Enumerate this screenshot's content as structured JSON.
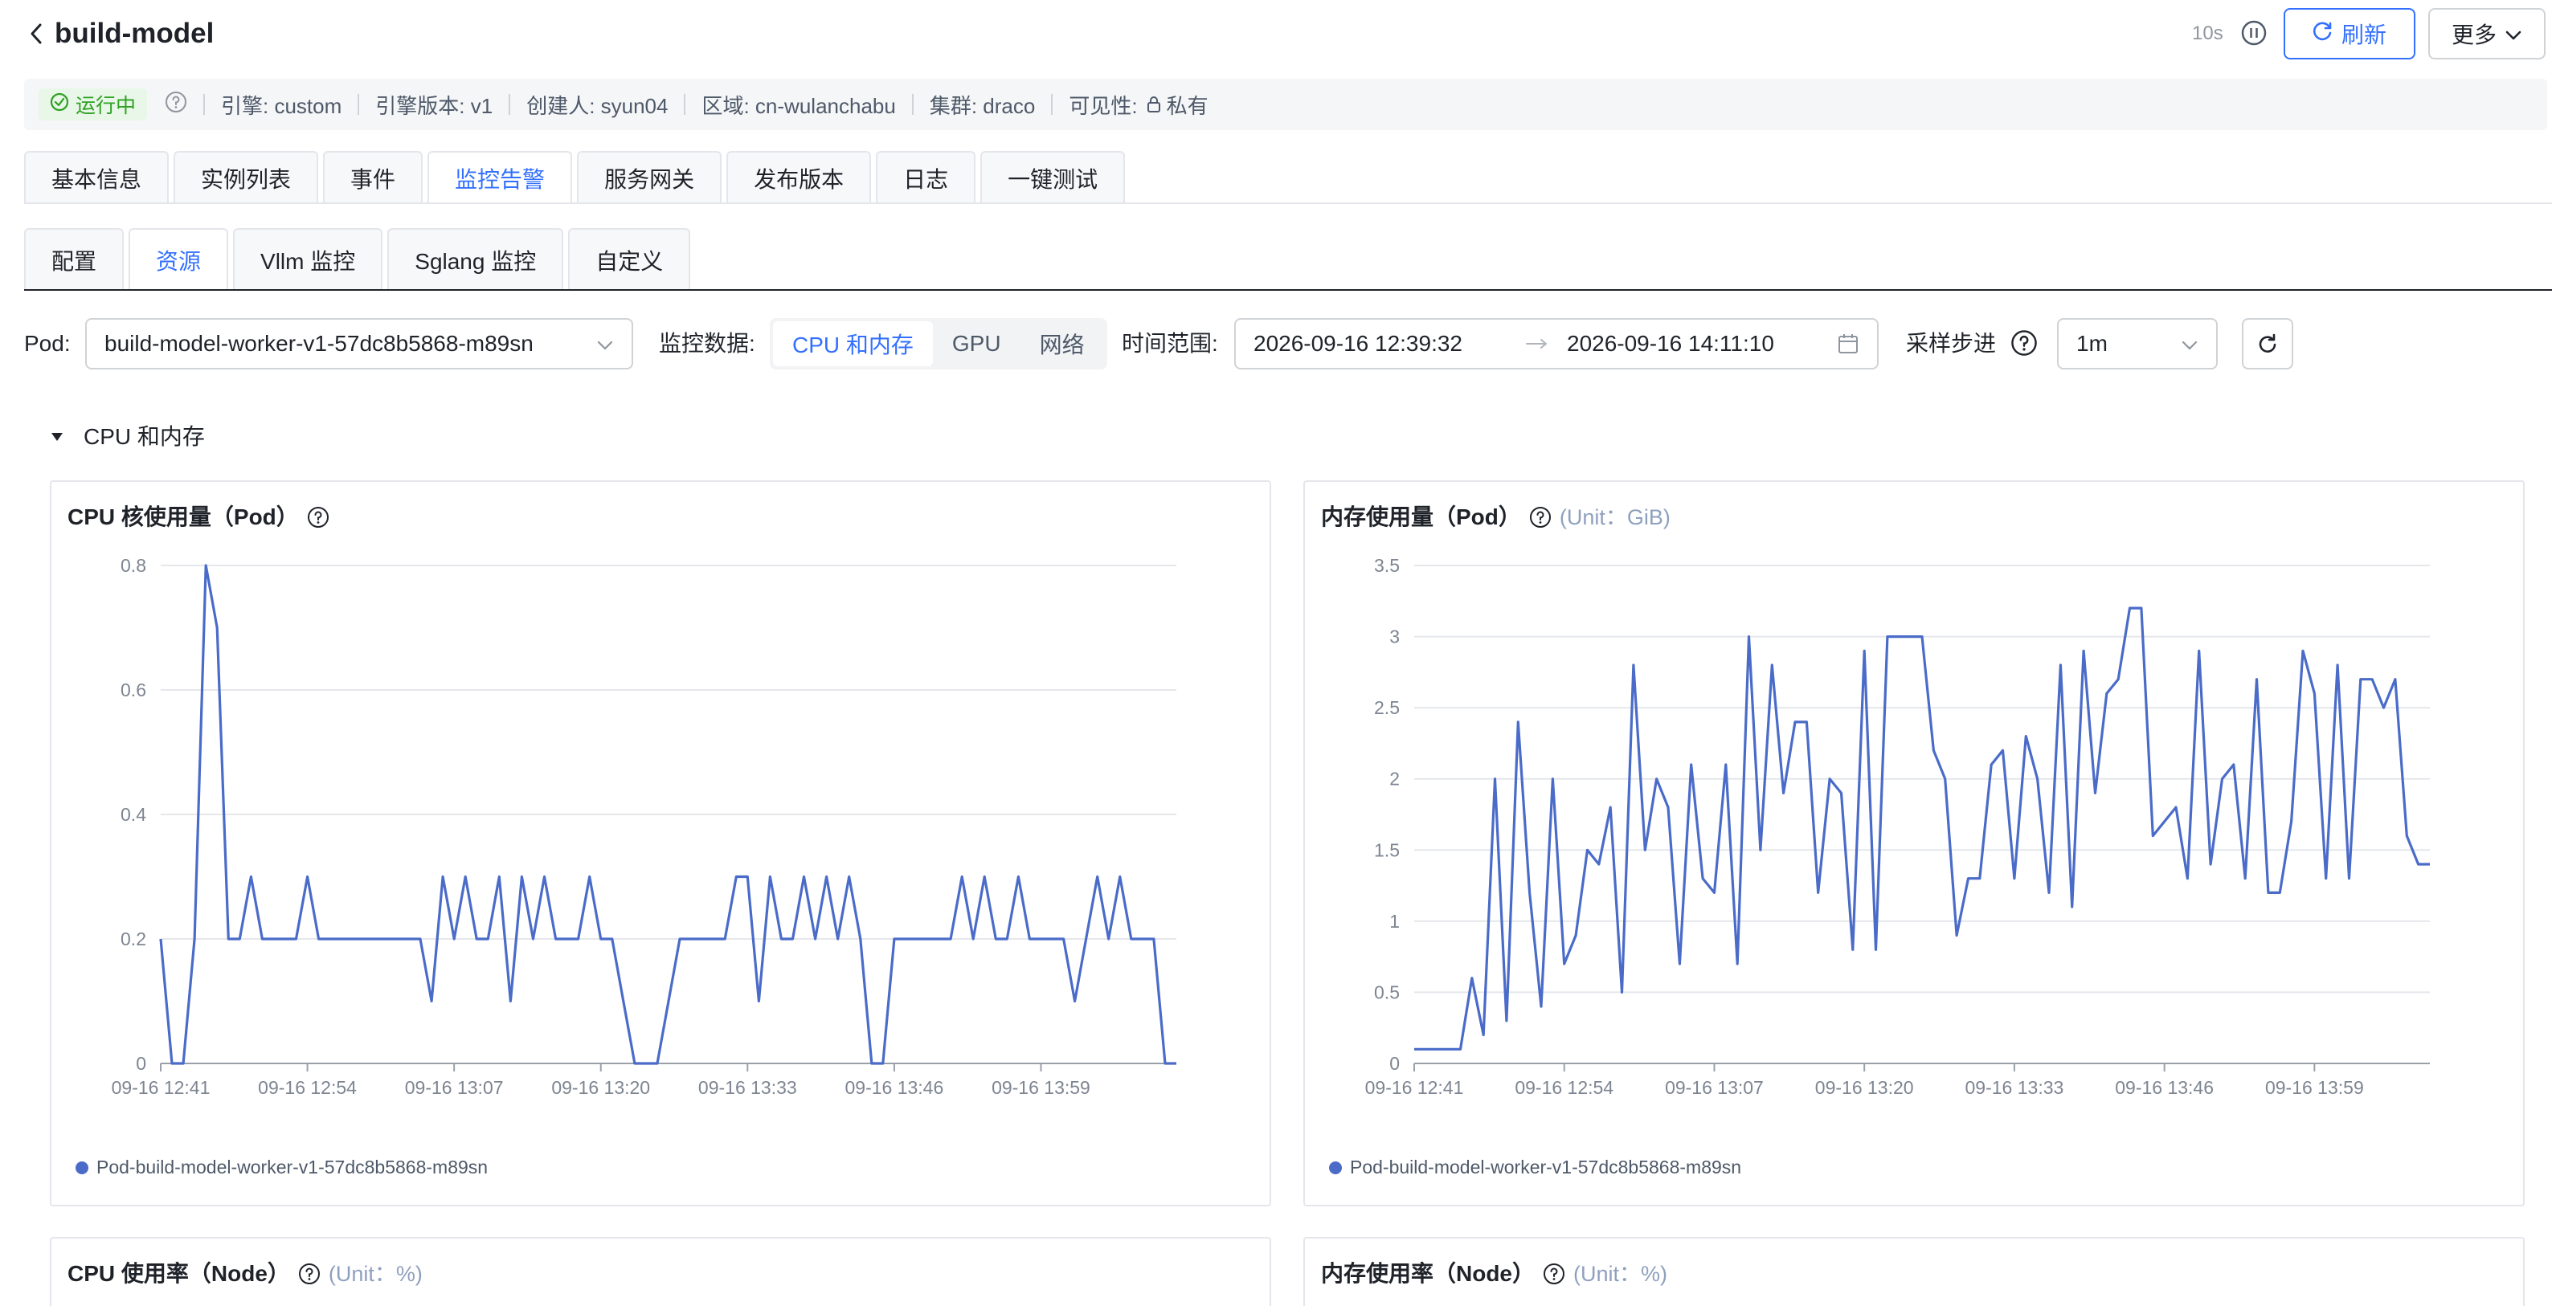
{
  "header": {
    "title": "build-model",
    "interval": "10s",
    "refresh_label": "刷新",
    "more_label": "更多"
  },
  "info": {
    "status": "运行中",
    "engine": "引擎: custom",
    "engine_version": "引擎版本: v1",
    "creator": "创建人: syun04",
    "region": "区域: cn-wulanchabu",
    "cluster": "集群: draco",
    "visibility_label": "可见性:",
    "visibility_value": "私有"
  },
  "tabs": [
    "基本信息",
    "实例列表",
    "事件",
    "监控告警",
    "服务网关",
    "发布版本",
    "日志",
    "一键测试"
  ],
  "subtabs": [
    "配置",
    "资源",
    "Vllm 监控",
    "Sglang 监控",
    "自定义"
  ],
  "filters": {
    "pod_label": "Pod:",
    "pod_value": "build-model-worker-v1-57dc8b5868-m89sn",
    "monitor_label": "监控数据:",
    "monitor_options": [
      "CPU 和内存",
      "GPU",
      "网络"
    ],
    "time_label": "时间范围:",
    "time_start": "2026-09-16 12:39:32",
    "time_end": "2026-09-16 14:11:10",
    "step_label": "采样步进",
    "step_value": "1m"
  },
  "section": {
    "title": "CPU 和内存"
  },
  "colors": {
    "accent": "#3370ff",
    "series": "#4a6bc8",
    "success": "#2ea121"
  },
  "chart_data": [
    {
      "type": "line",
      "title": "CPU 核使用量（Pod）",
      "unit": "",
      "ylim": [
        0,
        0.8
      ],
      "yticks": [
        "0",
        "0.2",
        "0.4",
        "0.6",
        "0.8"
      ],
      "ytick_values": [
        0,
        0.2,
        0.4,
        0.6,
        0.8
      ],
      "xticks": [
        "09-16 12:41",
        "09-16 12:54",
        "09-16 13:07",
        "09-16 13:20",
        "09-16 13:33",
        "09-16 13:46",
        "09-16 13:59"
      ],
      "grid": true,
      "legend_position": "bottom-left",
      "series": [
        {
          "name": "Pod-build-model-worker-v1-57dc8b5868-m89sn",
          "values": [
            0.2,
            0,
            0,
            0.2,
            0.8,
            0.7,
            0.2,
            0.2,
            0.3,
            0.2,
            0.2,
            0.2,
            0.2,
            0.3,
            0.2,
            0.2,
            0.2,
            0.2,
            0.2,
            0.2,
            0.2,
            0.2,
            0.2,
            0.2,
            0.1,
            0.3,
            0.2,
            0.3,
            0.2,
            0.2,
            0.3,
            0.1,
            0.3,
            0.2,
            0.3,
            0.2,
            0.2,
            0.2,
            0.3,
            0.2,
            0.2,
            0.1,
            0,
            0,
            0,
            0.1,
            0.2,
            0.2,
            0.2,
            0.2,
            0.2,
            0.3,
            0.3,
            0.1,
            0.3,
            0.2,
            0.2,
            0.3,
            0.2,
            0.3,
            0.2,
            0.3,
            0.2,
            0,
            0,
            0.2,
            0.2,
            0.2,
            0.2,
            0.2,
            0.2,
            0.3,
            0.2,
            0.3,
            0.2,
            0.2,
            0.3,
            0.2,
            0.2,
            0.2,
            0.2,
            0.1,
            0.2,
            0.3,
            0.2,
            0.3,
            0.2,
            0.2,
            0.2,
            0,
            0
          ]
        }
      ]
    },
    {
      "type": "line",
      "title": "内存使用量（Pod）",
      "unit": "(Unit：GiB)",
      "ylim": [
        0,
        3.5
      ],
      "yticks": [
        "0",
        "0.5",
        "1",
        "1.5",
        "2",
        "2.5",
        "3",
        "3.5"
      ],
      "ytick_values": [
        0,
        0.5,
        1,
        1.5,
        2,
        2.5,
        3,
        3.5
      ],
      "xticks": [
        "09-16 12:41",
        "09-16 12:54",
        "09-16 13:07",
        "09-16 13:20",
        "09-16 13:33",
        "09-16 13:46",
        "09-16 13:59"
      ],
      "grid": true,
      "legend_position": "bottom-left",
      "series": [
        {
          "name": "Pod-build-model-worker-v1-57dc8b5868-m89sn",
          "values": [
            0.1,
            0.1,
            0.1,
            0.1,
            0.1,
            0.6,
            0.2,
            2,
            0.3,
            2.4,
            1.2,
            0.4,
            2,
            0.7,
            0.9,
            1.5,
            1.4,
            1.8,
            0.5,
            2.8,
            1.5,
            2,
            1.8,
            0.7,
            2.1,
            1.3,
            1.2,
            2.1,
            0.7,
            3,
            1.5,
            2.8,
            1.9,
            2.4,
            2.4,
            1.2,
            2,
            1.9,
            0.8,
            2.9,
            0.8,
            3,
            3,
            3,
            3,
            2.2,
            2,
            0.9,
            1.3,
            1.3,
            2.1,
            2.2,
            1.3,
            2.3,
            2,
            1.2,
            2.8,
            1.1,
            2.9,
            1.9,
            2.6,
            2.7,
            3.2,
            3.2,
            1.6,
            1.7,
            1.8,
            1.3,
            2.9,
            1.4,
            2,
            2.1,
            1.3,
            2.7,
            1.2,
            1.2,
            1.7,
            2.9,
            2.6,
            1.3,
            2.8,
            1.3,
            2.7,
            2.7,
            2.5,
            2.7,
            1.6,
            1.4,
            1.4
          ]
        }
      ]
    },
    {
      "type": "line",
      "title": "CPU 使用率（Node）",
      "unit": "(Unit：%)"
    },
    {
      "type": "line",
      "title": "内存使用率（Node）",
      "unit": "(Unit：%)"
    }
  ]
}
